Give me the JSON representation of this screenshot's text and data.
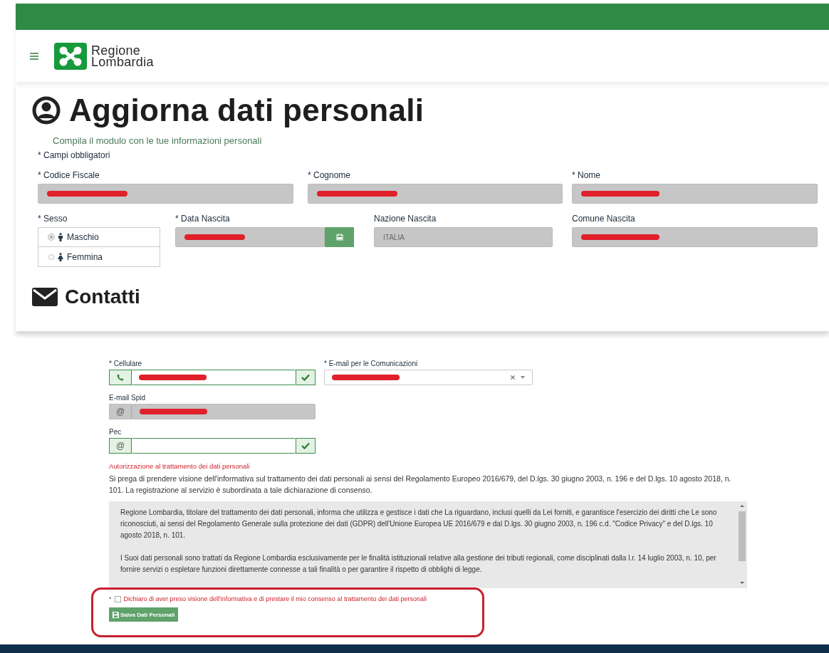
{
  "header": {
    "logo_lines": [
      "Regione",
      "Lombardia"
    ]
  },
  "personal": {
    "title": "Aggiorna dati personali",
    "subtitle": "Compila il modulo con le tue informazioni personali",
    "required_note": "* Campi obbligatori",
    "fields": [
      {
        "kind": "text",
        "label": "* Codice Fiscale",
        "redacted": true,
        "disabled": true
      },
      {
        "kind": "text",
        "label": "* Cognome",
        "redacted": true,
        "disabled": true
      },
      {
        "kind": "text",
        "label": "* Nome",
        "redacted": true,
        "disabled": true
      },
      {
        "kind": "radio",
        "label": "* Sesso",
        "options": [
          {
            "label": "Maschio",
            "selected": true
          },
          {
            "label": "Femmina",
            "selected": false
          }
        ]
      },
      {
        "kind": "date",
        "label": "* Data Nascita",
        "redacted": true,
        "disabled": true
      },
      {
        "kind": "text",
        "label": "Nazione Nascita",
        "value": "ITALIA",
        "redacted": false,
        "disabled": true
      },
      {
        "kind": "text",
        "label": "Comune Nascita",
        "redacted": true,
        "disabled": true
      }
    ]
  },
  "contacts": {
    "title": "Contatti",
    "fields": [
      {
        "kind": "phone",
        "label": "* Cellulare",
        "redacted": true,
        "disabled": false,
        "valid": true
      },
      {
        "kind": "select",
        "label": "* E-mail per le Comunicazioni",
        "redacted": true,
        "disabled": false,
        "valid": false
      },
      {
        "kind": "email",
        "label": "E-mail Spid",
        "addon": "@",
        "redacted": true,
        "disabled": true,
        "valid": false
      },
      {
        "kind": "email",
        "label": "Pec",
        "addon": "@",
        "redacted": false,
        "disabled": false,
        "valid": true
      }
    ]
  },
  "consent": {
    "heading": "Autorizzazione al trattamento dei dati personali",
    "intro": "Si prega di prendere visione dell'informativa sul trattamento dei dati personali ai sensi del Regolamento Europeo 2016/679, del D.lgs. 30 giugno 2003, n. 196 e del D.lgs. 10 agosto 2018, n. 101. La registrazione al servizio è subordinata a tale dichiarazione di consenso.",
    "policy_paragraphs": [
      "Regione Lombardia, titolare del trattamento dei dati personali, informa che utilizza e gestisce i dati che La riguardano, inclusi quelli da Lei forniti, e garantisce l'esercizio dei diritti che Le sono riconosciuti, ai sensi del Regolamento Generale sulla protezione dei dati (GDPR) dell'Unione Europea UE 2016/679 e dal D.lgs. 30 giugno 2003, n. 196 c.d. \"Codice Privacy\" e del D.lgs. 10 agosto 2018, n. 101.",
      "I Suoi dati personali sono trattati da Regione Lombardia esclusivamente per le finalità istituzionali relative alla gestione dei tributi regionali, come disciplinati dalla l.r. 14 luglio 2003, n. 10, per fornire servizi o espletare funzioni direttamente connesse a tali finalità o per garantire il rispetto di obblighi di legge."
    ],
    "checkbox": {
      "required_mark": "*",
      "label": "Dichiaro di aver preso visione dell'informativa e di prestare il mio consenso al trattamento dei dati personali",
      "checked": false
    },
    "save_button": "Salva Dati Personali"
  }
}
